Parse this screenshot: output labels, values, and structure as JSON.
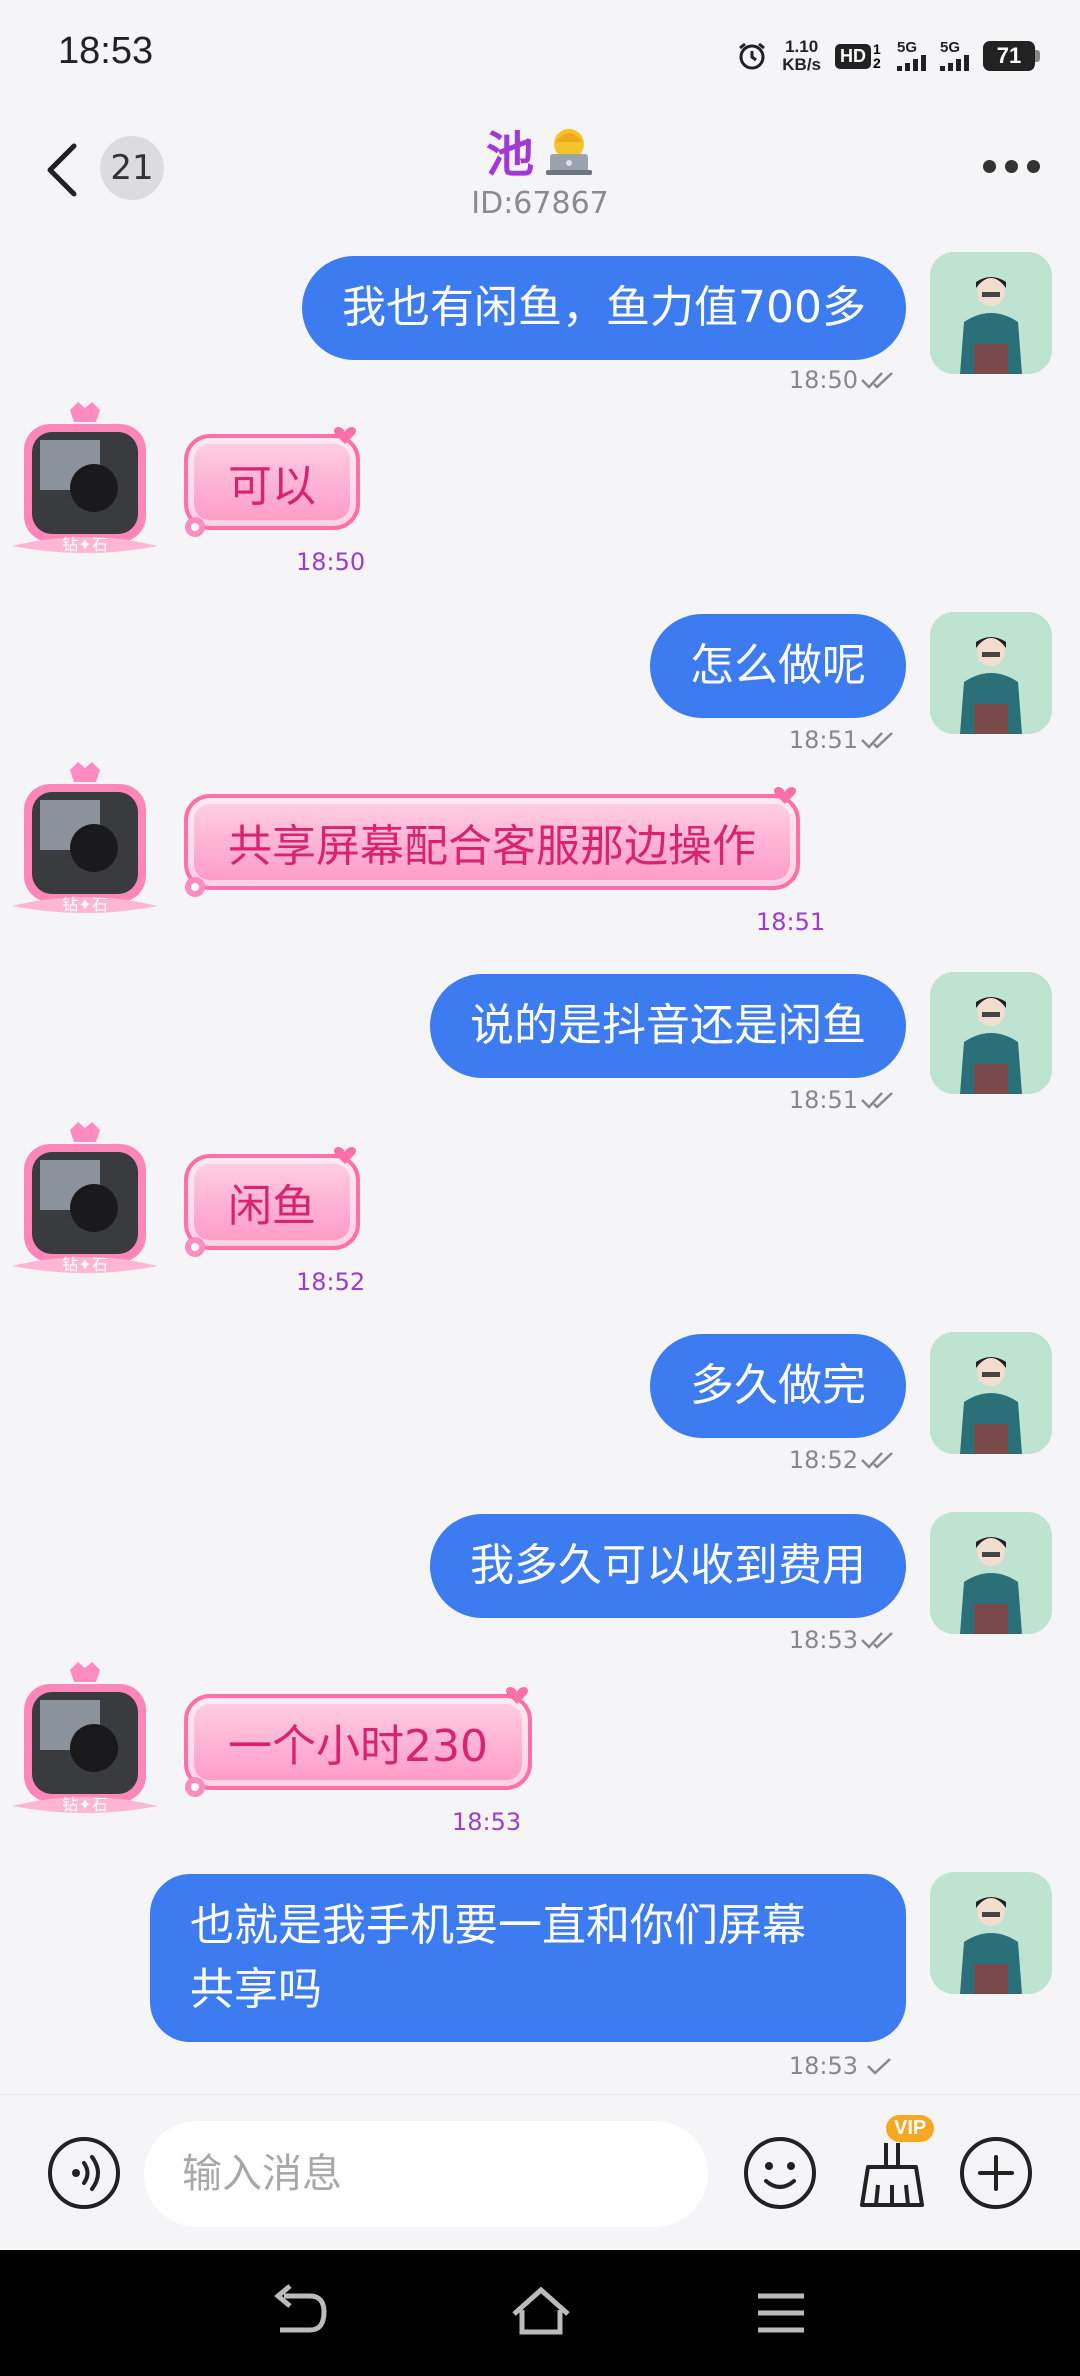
{
  "status_bar": {
    "time": "18:53",
    "net_speed_value": "1.10",
    "net_speed_unit": "KB/s",
    "hd_label": "HD",
    "hd_sub": "1 2",
    "sim1_label": "5G",
    "sim2_label": "5G",
    "battery": "71"
  },
  "header": {
    "unread_count": "21",
    "contact_name": "池",
    "contact_id": "ID:67867",
    "title_icon": "person-laptop-emoji"
  },
  "messages": [
    {
      "side": "out",
      "text": "我也有闲鱼，鱼力值700多",
      "time": "18:50"
    },
    {
      "side": "in",
      "text": "可以",
      "time": "18:50"
    },
    {
      "side": "out",
      "text": "怎么做呢",
      "time": "18:51"
    },
    {
      "side": "in",
      "text": "共享屏幕配合客服那边操作",
      "time": "18:51"
    },
    {
      "side": "out",
      "text": "说的是抖音还是闲鱼",
      "time": "18:51"
    },
    {
      "side": "in",
      "text": "闲鱼",
      "time": "18:52"
    },
    {
      "side": "out",
      "text": "多久做完",
      "time": "18:52"
    },
    {
      "side": "out",
      "text": "我多久可以收到费用",
      "time": "18:53"
    },
    {
      "side": "in",
      "text": "一个小时230",
      "time": "18:53"
    },
    {
      "side": "out",
      "text_line1": "也就是我手机要一直和你们屏幕",
      "text_line2": "共享吗",
      "time": "18:53"
    }
  ],
  "avatar_badge": "钻✦石",
  "input_bar": {
    "placeholder": "输入消息",
    "vip_badge": "VIP"
  },
  "colors": {
    "outgoing_bubble": "#3c7bf0",
    "incoming_text": "#d9236e",
    "incoming_time": "#9d3bd0",
    "title": "#a338d6"
  }
}
